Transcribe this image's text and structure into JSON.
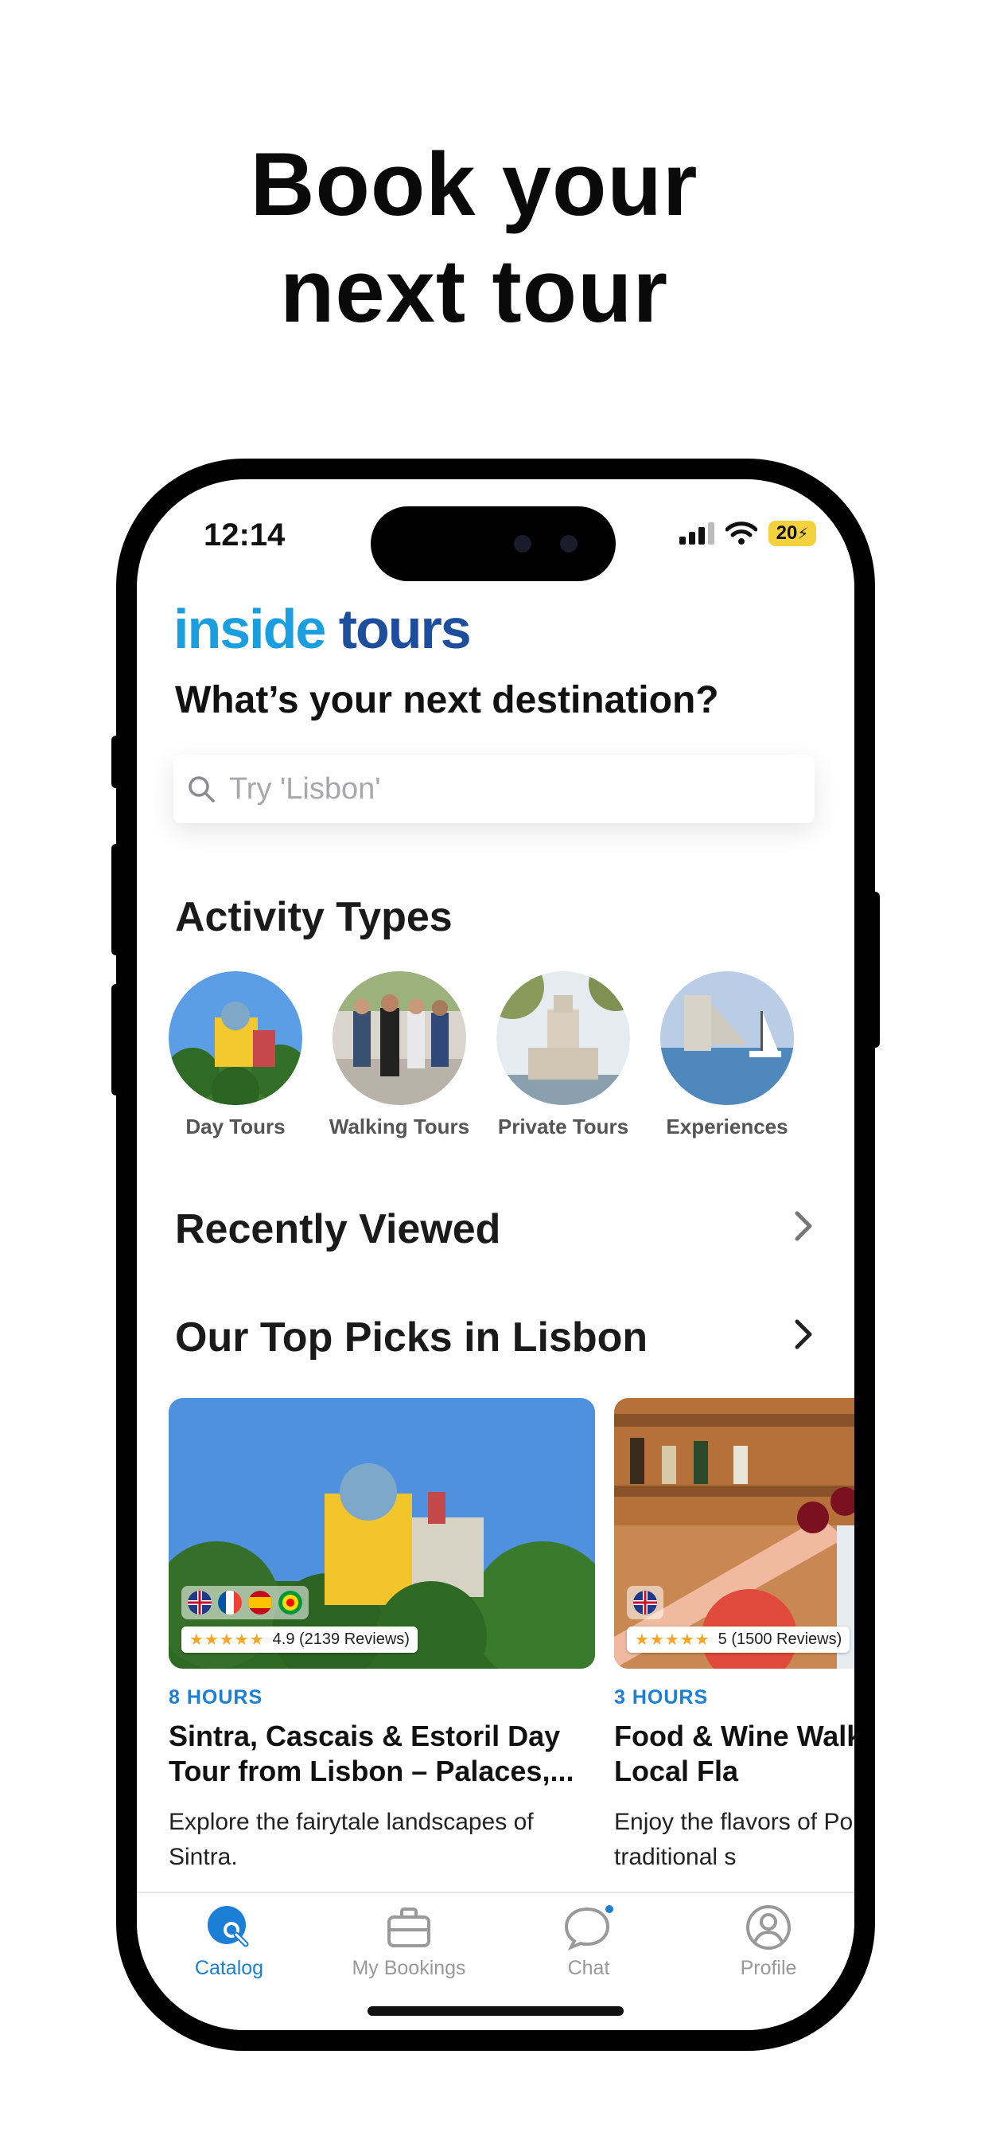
{
  "headline": {
    "line1": "Book your",
    "line2": "next tour"
  },
  "status": {
    "time": "12:14",
    "battery": "20"
  },
  "brand": {
    "part1": "inside",
    "part2": " tours"
  },
  "question": "What’s your next destination?",
  "search": {
    "placeholder": "Try 'Lisbon'"
  },
  "activity_types": {
    "title": "Activity Types",
    "items": [
      {
        "label": "Day Tours"
      },
      {
        "label": "Walking Tours"
      },
      {
        "label": "Private Tours"
      },
      {
        "label": "Experiences"
      }
    ]
  },
  "recently_viewed": {
    "title": "Recently Viewed"
  },
  "top_picks": {
    "title": "Our Top Picks in Lisbon",
    "cards": [
      {
        "hours": "8 HOURS",
        "title": "Sintra, Cascais & Estoril Day Tour from Lisbon – Palaces,...",
        "description": "Explore the fairytale landscapes of Sintra.",
        "rating_text": "4.9 (2139 Reviews)",
        "stars": "★★★★★"
      },
      {
        "hours": "3 HOURS",
        "title": "Food & Wine Walk Discover Local Fla",
        "description": "Enjoy the flavors of Por in Lisbon’s traditional s",
        "rating_text": "5 (1500 Reviews)",
        "stars": "★★★★★"
      }
    ]
  },
  "tabbar": {
    "items": [
      {
        "label": "Catalog",
        "icon": "catalog-search-icon",
        "active": true
      },
      {
        "label": "My Bookings",
        "icon": "briefcase-icon"
      },
      {
        "label": "Chat",
        "icon": "chat-bubble-icon"
      },
      {
        "label": "Profile",
        "icon": "profile-icon"
      }
    ]
  },
  "colors": {
    "accent": "#1b7fd6",
    "brand_light": "#1a9ee0",
    "brand_dark": "#1d4e9e",
    "star": "#f5a623"
  }
}
